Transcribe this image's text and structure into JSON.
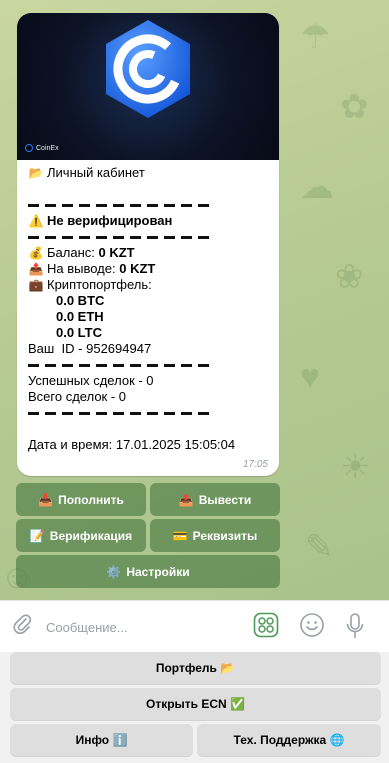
{
  "message": {
    "banner_brand": "CoinEx",
    "header": "Личный кабинет",
    "status": "Не верифицирован",
    "balance_label": "Баланс:",
    "balance_value": "0 KZT",
    "withdraw_label": "На выводе:",
    "withdraw_value": "0 KZT",
    "portfolio_label": "Криптопортфель:",
    "crypto": [
      "0.0 BTC",
      "0.0 ETH",
      "0.0 LTC"
    ],
    "user_id": "Ваш  ID - 952694947",
    "deals_success": "Успешных сделок - 0",
    "deals_total": "Всего сделок - 0",
    "datetime": "Дата и время: 17.01.2025 15:05:04",
    "time": "17:05"
  },
  "inline_keyboard": {
    "deposit": "Пополнить",
    "withdraw": "Вывести",
    "verify": "Верификация",
    "requisites": "Реквизиты",
    "settings": "Настройки"
  },
  "input": {
    "placeholder": "Сообщение..."
  },
  "reply_keyboard": {
    "portfolio": "Портфель 📂",
    "open_ecn": "Открыть ECN ✅",
    "info": "Инфо ℹ️",
    "support": "Тех. Поддержка 🌐"
  },
  "colors": {
    "brand": "#2f7cff",
    "inline_button": "#4f7d47",
    "chat_background": "#bfcf9a"
  }
}
